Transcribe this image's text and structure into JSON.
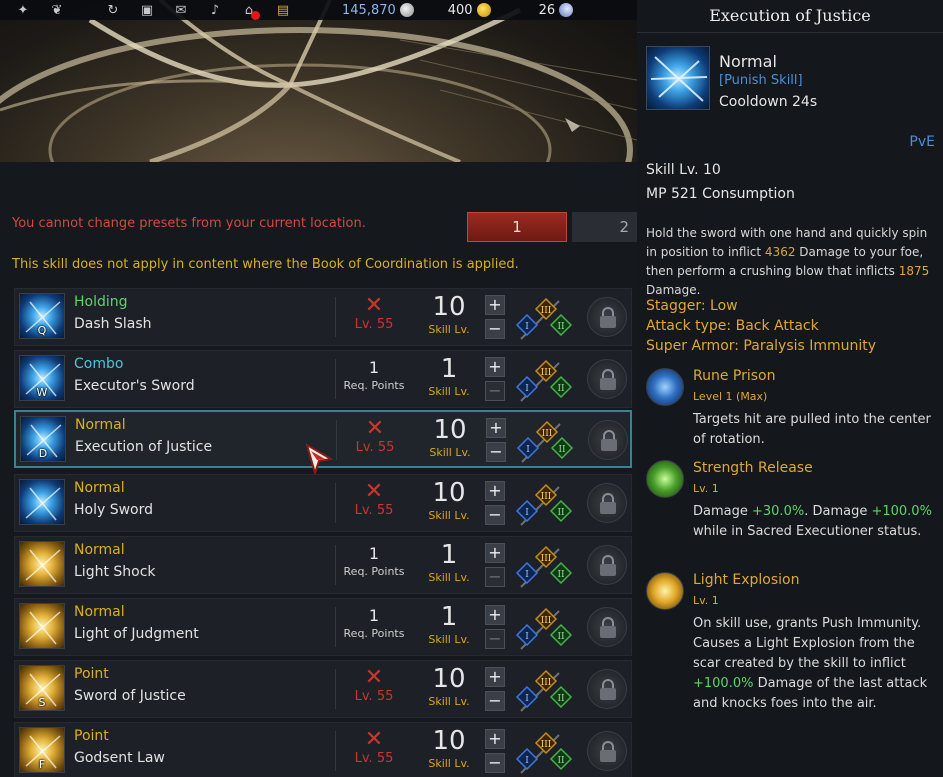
{
  "topbar": {
    "currencies": [
      {
        "value": "145,870",
        "icon": "silver-coin-icon"
      },
      {
        "value": "400",
        "icon": "gold-coin-icon"
      },
      {
        "value": "26",
        "icon": "moon-icon"
      }
    ]
  },
  "left": {
    "warning_location": "You cannot change presets from your current location.",
    "preset_tabs": [
      "1",
      "2"
    ],
    "warning_book": "This skill does not apply in content where the Book of Coordination is applied.",
    "req_label": "Req. Points",
    "skill_lv_label": "Skill Lv.",
    "skills": [
      {
        "key": "Q",
        "type": "Holding",
        "name": "Dash Slash",
        "req": "Lv. 55",
        "level": "10"
      },
      {
        "key": "W",
        "type": "Combo",
        "name": "Executor's Sword",
        "req": "1",
        "level": "1"
      },
      {
        "key": "D",
        "type": "Normal",
        "name": "Execution of Justice",
        "req": "Lv. 55",
        "level": "10"
      },
      {
        "key": "",
        "type": "Normal",
        "name": "Holy Sword",
        "req": "Lv. 55",
        "level": "10"
      },
      {
        "key": "",
        "type": "Normal",
        "name": "Light Shock",
        "req": "1",
        "level": "1"
      },
      {
        "key": "",
        "type": "Normal",
        "name": "Light of Judgment",
        "req": "1",
        "level": "1"
      },
      {
        "key": "S",
        "type": "Point",
        "name": "Sword of Justice",
        "req": "Lv. 55",
        "level": "10"
      },
      {
        "key": "F",
        "type": "Point",
        "name": "Godsent Law",
        "req": "Lv. 55",
        "level": "10"
      }
    ],
    "tripod_numerals": [
      "III",
      "I",
      "II"
    ]
  },
  "tooltip": {
    "title": "Execution of Justice",
    "grade": "Normal",
    "category": "[Punish Skill]",
    "cooldown": "Cooldown 24s",
    "mode": "PvE",
    "skill_level": "Skill Lv. 10",
    "mp": "MP 521 Consumption",
    "desc_1": "Hold the sword with one hand and quickly spin in position to inflict ",
    "desc_dmg1": "4362",
    "desc_2": " Damage to your foe, then perform a crushing blow that inflicts ",
    "desc_dmg2": "1875",
    "desc_3": " Damage.",
    "stagger": "Stagger: Low",
    "attack_type": "Attack type: Back Attack",
    "super_armor": "Super Armor: Paralysis Immunity",
    "tripods": [
      {
        "name": "Rune Prison",
        "level": "Level 1 (Max)",
        "desc": "Targets hit are pulled into the center of rotation."
      },
      {
        "name": "Strength Release",
        "level": "Lv. 1",
        "d1": "Damage ",
        "v1": "+30.0%",
        "d2": ". Damage ",
        "v2": "+100.0%",
        "d3": " while in Sacred Executioner status."
      },
      {
        "name": "Light Explosion",
        "level": "Lv. 1",
        "d1": "On skill use, grants Push Immunity.",
        "d2": "Causes a Light Explosion from the scar created by the skill to inflict ",
        "v1": "+100.0%",
        "d3": " Damage of the last attack and knocks foes into the air."
      }
    ]
  }
}
